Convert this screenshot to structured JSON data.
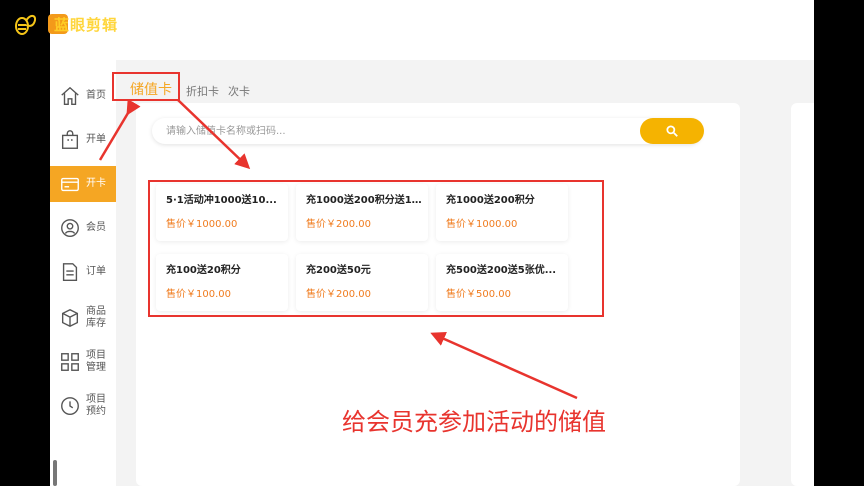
{
  "watermark": {
    "text": "蓝眼剪辑"
  },
  "sidebar": {
    "items": [
      {
        "label": "首页",
        "icon": "home-icon"
      },
      {
        "label": "开单",
        "icon": "shopping-bag-icon"
      },
      {
        "label": "开卡",
        "icon": "card-icon",
        "active": true
      },
      {
        "label": "会员",
        "icon": "member-icon"
      },
      {
        "label": "订单",
        "icon": "order-document-icon"
      },
      {
        "label": "商品库存",
        "icon": "box-icon"
      },
      {
        "label": "项目管理",
        "icon": "grid-icon"
      },
      {
        "label": "项目预约",
        "icon": "clock-icon"
      }
    ]
  },
  "tabs": [
    {
      "label": "储值卡",
      "active": true
    },
    {
      "label": "折扣卡"
    },
    {
      "label": "次卡"
    }
  ],
  "search": {
    "placeholder": "请输入储值卡名称或扫码..."
  },
  "cards": [
    {
      "name": "5·1活动冲1000送10...",
      "price": "售价￥1000.00"
    },
    {
      "name": "充1000送200积分送1...",
      "price": "售价￥200.00"
    },
    {
      "name": "充1000送200积分",
      "price": "售价￥1000.00"
    },
    {
      "name": "充100送20积分",
      "price": "售价￥100.00"
    },
    {
      "name": "充200送50元",
      "price": "售价￥200.00"
    },
    {
      "name": "充500送200送5张优...",
      "price": "售价￥500.00"
    }
  ],
  "annotation": {
    "text": "给会员充参加活动的储值"
  },
  "colors": {
    "accent": "#f5a623",
    "search_button": "#f5b301",
    "price": "#f07c1f",
    "annotation": "#e8342e"
  }
}
